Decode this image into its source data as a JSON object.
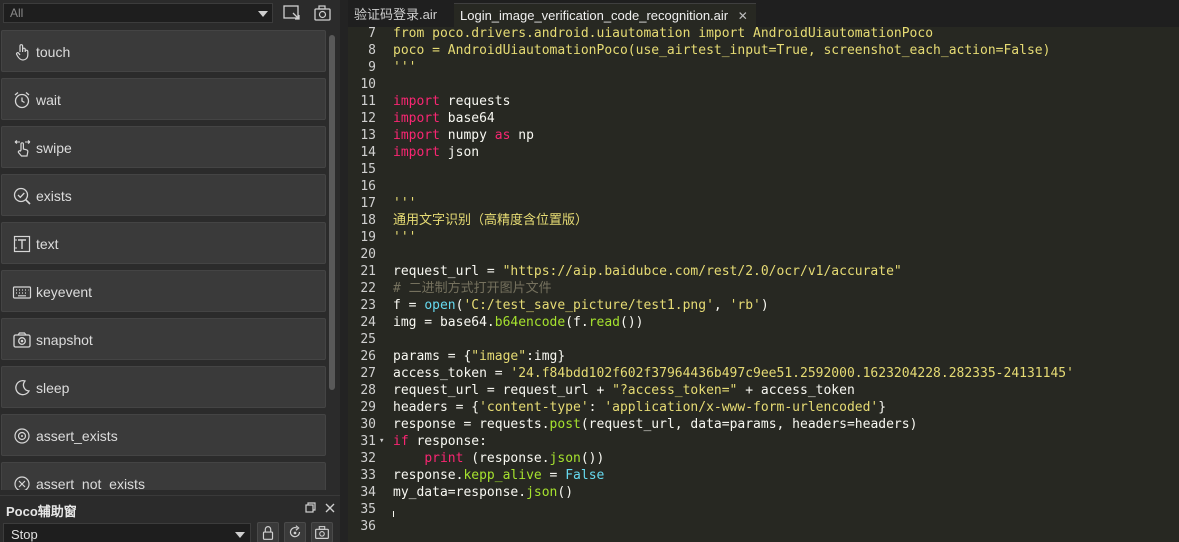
{
  "toolbar": {
    "filter_value": "All",
    "icons": [
      "record-screen-icon",
      "device-screenshot-icon"
    ]
  },
  "actions": [
    {
      "label": "touch",
      "icon": "touch-icon"
    },
    {
      "label": "wait",
      "icon": "alarm-clock-icon"
    },
    {
      "label": "swipe",
      "icon": "swipe-icon"
    },
    {
      "label": "exists",
      "icon": "magnifier-check-icon"
    },
    {
      "label": "text",
      "icon": "text-icon"
    },
    {
      "label": "keyevent",
      "icon": "keyboard-icon"
    },
    {
      "label": "snapshot",
      "icon": "camera-icon"
    },
    {
      "label": "sleep",
      "icon": "moon-icon"
    },
    {
      "label": "assert_exists",
      "icon": "target-icon"
    },
    {
      "label": "assert_not_exists",
      "icon": "target-cross-icon"
    }
  ],
  "poco_panel": {
    "title": "Poco辅助窗",
    "mode_value": "Stop",
    "buttons": [
      "lock-icon",
      "refresh-icon",
      "camera-icon"
    ]
  },
  "editor": {
    "tabs": [
      {
        "label": "验证码登录.air",
        "active": false
      },
      {
        "label": "Login_image_verification_code_recognition.air",
        "active": true
      }
    ],
    "lines": [
      {
        "n": "7",
        "tokens": [
          {
            "t": "from poco.drivers.android.uiautomation import AndroidUiautomationPoco",
            "c": "str"
          }
        ]
      },
      {
        "n": "8",
        "tokens": [
          {
            "t": "poco = AndroidUiautomationPoco(use_airtest_input=True, screenshot_each_action=False)",
            "c": "str"
          }
        ]
      },
      {
        "n": "9",
        "tokens": [
          {
            "t": "'''",
            "c": "str"
          }
        ]
      },
      {
        "n": "10",
        "tokens": []
      },
      {
        "n": "11",
        "tokens": [
          {
            "t": "import",
            "c": "kw"
          },
          {
            "t": " requests",
            "c": "plain"
          }
        ]
      },
      {
        "n": "12",
        "tokens": [
          {
            "t": "import",
            "c": "kw"
          },
          {
            "t": " base64",
            "c": "plain"
          }
        ]
      },
      {
        "n": "13",
        "tokens": [
          {
            "t": "import",
            "c": "kw"
          },
          {
            "t": " numpy ",
            "c": "plain"
          },
          {
            "t": "as",
            "c": "kw"
          },
          {
            "t": " np",
            "c": "plain"
          }
        ]
      },
      {
        "n": "14",
        "tokens": [
          {
            "t": "import",
            "c": "kw"
          },
          {
            "t": " json",
            "c": "plain"
          }
        ]
      },
      {
        "n": "15",
        "tokens": []
      },
      {
        "n": "16",
        "tokens": []
      },
      {
        "n": "17",
        "tokens": [
          {
            "t": "'''",
            "c": "str"
          }
        ]
      },
      {
        "n": "18",
        "tokens": [
          {
            "t": "通用文字识别（高精度含位置版）",
            "c": "str"
          }
        ]
      },
      {
        "n": "19",
        "tokens": [
          {
            "t": "'''",
            "c": "str"
          }
        ]
      },
      {
        "n": "20",
        "tokens": []
      },
      {
        "n": "21",
        "tokens": [
          {
            "t": "request_url = ",
            "c": "plain"
          },
          {
            "t": "\"https://aip.baidubce.com/rest/2.0/ocr/v1/accurate\"",
            "c": "str"
          }
        ]
      },
      {
        "n": "22",
        "tokens": [
          {
            "t": "# 二进制方式打开图片文件",
            "c": "com"
          }
        ]
      },
      {
        "n": "23",
        "tokens": [
          {
            "t": "f = ",
            "c": "plain"
          },
          {
            "t": "open",
            "c": "bi"
          },
          {
            "t": "(",
            "c": "plain"
          },
          {
            "t": "'C:/test_save_picture/test1.png'",
            "c": "str"
          },
          {
            "t": ", ",
            "c": "plain"
          },
          {
            "t": "'rb'",
            "c": "str"
          },
          {
            "t": ")",
            "c": "plain"
          }
        ]
      },
      {
        "n": "24",
        "tokens": [
          {
            "t": "img = base64.",
            "c": "plain"
          },
          {
            "t": "b64encode",
            "c": "fn"
          },
          {
            "t": "(f.",
            "c": "plain"
          },
          {
            "t": "read",
            "c": "fn"
          },
          {
            "t": "())",
            "c": "plain"
          }
        ]
      },
      {
        "n": "25",
        "tokens": []
      },
      {
        "n": "26",
        "tokens": [
          {
            "t": "params = {",
            "c": "plain"
          },
          {
            "t": "\"image\"",
            "c": "str"
          },
          {
            "t": ":img}",
            "c": "plain"
          }
        ]
      },
      {
        "n": "27",
        "tokens": [
          {
            "t": "access_token = ",
            "c": "plain"
          },
          {
            "t": "'24.f84bdd102f602f37964436b497c9ee51.2592000.1623204228.282335-24131145'",
            "c": "str"
          }
        ]
      },
      {
        "n": "28",
        "tokens": [
          {
            "t": "request_url = request_url + ",
            "c": "plain"
          },
          {
            "t": "\"?access_token=\"",
            "c": "str"
          },
          {
            "t": " + access_token",
            "c": "plain"
          }
        ]
      },
      {
        "n": "29",
        "tokens": [
          {
            "t": "headers = {",
            "c": "plain"
          },
          {
            "t": "'content-type'",
            "c": "str"
          },
          {
            "t": ": ",
            "c": "plain"
          },
          {
            "t": "'application/x-www-form-urlencoded'",
            "c": "str"
          },
          {
            "t": "}",
            "c": "plain"
          }
        ]
      },
      {
        "n": "30",
        "tokens": [
          {
            "t": "response = requests.",
            "c": "plain"
          },
          {
            "t": "post",
            "c": "fn"
          },
          {
            "t": "(request_url, data=params, headers=headers)",
            "c": "plain"
          }
        ]
      },
      {
        "n": "31",
        "fold": "▾",
        "tokens": [
          {
            "t": "if",
            "c": "kw"
          },
          {
            "t": " response:",
            "c": "plain"
          }
        ]
      },
      {
        "n": "32",
        "tokens": [
          {
            "t": "    ",
            "c": "plain"
          },
          {
            "t": "print",
            "c": "kw"
          },
          {
            "t": " (response.",
            "c": "plain"
          },
          {
            "t": "json",
            "c": "fn"
          },
          {
            "t": "())",
            "c": "plain"
          }
        ]
      },
      {
        "n": "33",
        "tokens": [
          {
            "t": "response.",
            "c": "plain"
          },
          {
            "t": "kepp_alive",
            "c": "fn"
          },
          {
            "t": " = ",
            "c": "plain"
          },
          {
            "t": "False",
            "c": "bi"
          }
        ]
      },
      {
        "n": "34",
        "tokens": [
          {
            "t": "my_data=response.",
            "c": "plain"
          },
          {
            "t": "json",
            "c": "fn"
          },
          {
            "t": "()",
            "c": "plain"
          }
        ]
      },
      {
        "n": "35",
        "tokens": []
      },
      {
        "n": "36",
        "tokens": []
      }
    ]
  },
  "colors": {
    "editor_bg": "#272822",
    "keyword": "#f92672",
    "string": "#e6db74",
    "builtin": "#66d9ef",
    "function": "#a6e22e",
    "comment": "#75715e"
  }
}
